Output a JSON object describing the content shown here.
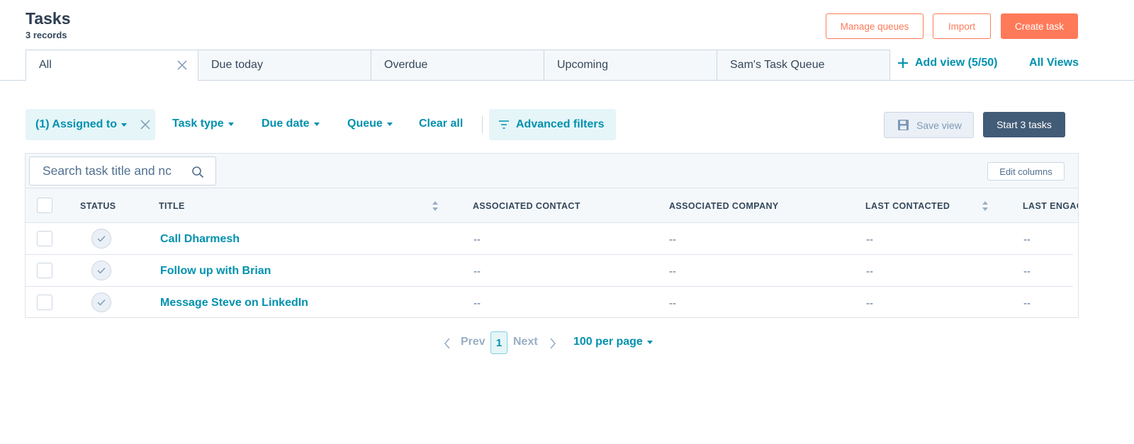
{
  "header": {
    "title": "Tasks",
    "record_count": "3 records",
    "buttons": {
      "manage_queues": "Manage queues",
      "import": "Import",
      "create_task": "Create task"
    }
  },
  "tabs": [
    {
      "label": "All",
      "active": true,
      "closable": true
    },
    {
      "label": "Due today"
    },
    {
      "label": "Overdue"
    },
    {
      "label": "Upcoming"
    },
    {
      "label": "Sam's Task Queue"
    }
  ],
  "view_actions": {
    "add_view": "Add view (5/50)",
    "all_views": "All Views"
  },
  "filters": {
    "assigned_to": "(1) Assigned to",
    "task_type": "Task type",
    "due_date": "Due date",
    "queue": "Queue",
    "clear_all": "Clear all",
    "advanced_filters": "Advanced filters"
  },
  "actions": {
    "save_view": "Save view",
    "start_tasks": "Start 3 tasks"
  },
  "table": {
    "search_value": "Search task title and nc",
    "edit_columns": "Edit columns",
    "columns": {
      "status": "STATUS",
      "title": "TITLE",
      "associated_contact": "ASSOCIATED CONTACT",
      "associated_company": "ASSOCIATED COMPANY",
      "last_contacted": "LAST CONTACTED",
      "last_engagement": "LAST ENGAG"
    },
    "rows": [
      {
        "title": "Call Dharmesh",
        "associated_contact": "--",
        "associated_company": "--",
        "last_contacted": "--",
        "last_engagement": "--"
      },
      {
        "title": "Follow up with Brian",
        "associated_contact": "--",
        "associated_company": "--",
        "last_contacted": "--",
        "last_engagement": "--"
      },
      {
        "title": "Message Steve on LinkedIn",
        "associated_contact": "--",
        "associated_company": "--",
        "last_contacted": "--",
        "last_engagement": "--"
      }
    ]
  },
  "pagination": {
    "prev": "Prev",
    "current_page": "1",
    "next": "Next",
    "per_page": "100 per page"
  },
  "colors": {
    "accent_orange": "#ff7a59",
    "link_teal": "#0091ae",
    "dark_slate": "#425b76",
    "border": "#cbd6e2"
  }
}
